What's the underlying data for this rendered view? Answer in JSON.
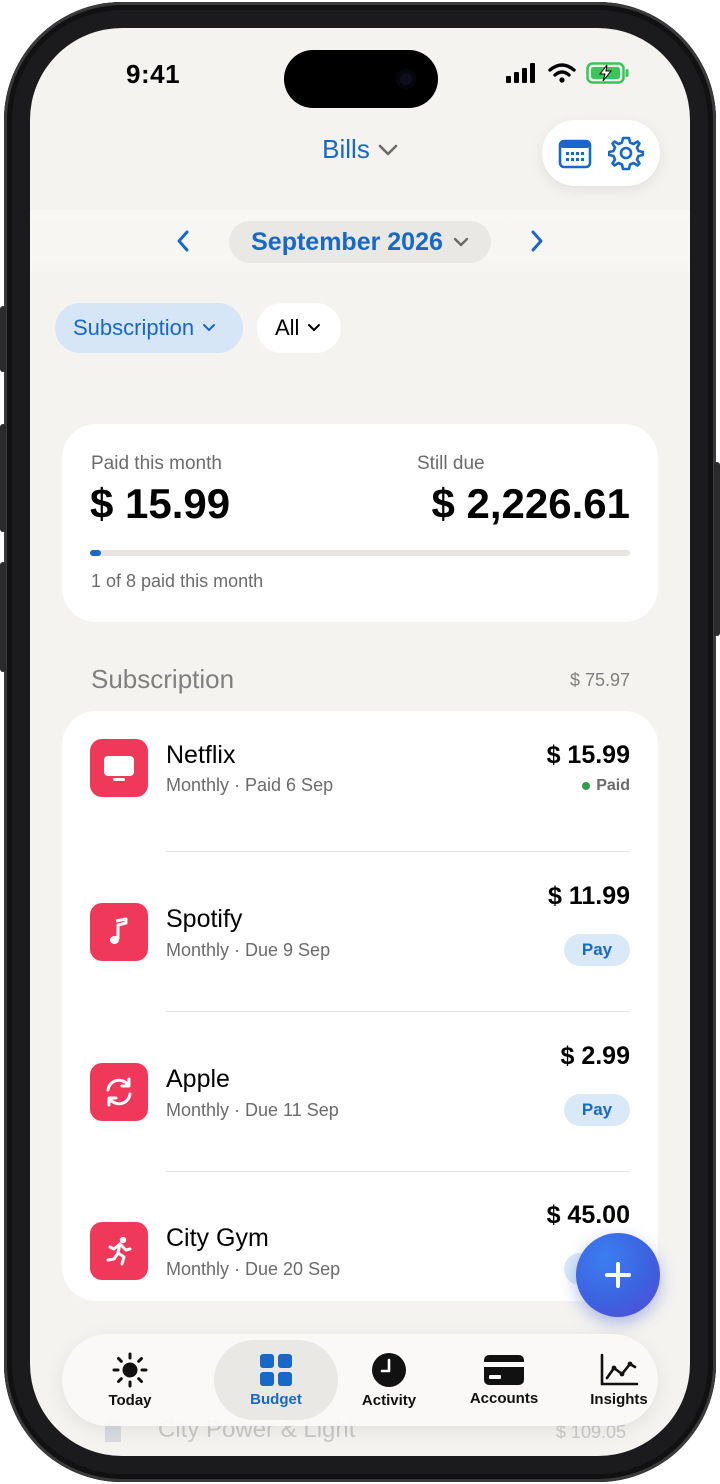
{
  "status_bar": {
    "time": "9:41"
  },
  "header": {
    "title": "Bills"
  },
  "month": {
    "label": "September 2026"
  },
  "filters": {
    "category": "Subscription",
    "scope": "All"
  },
  "summary": {
    "paid_label": "Paid this month",
    "paid_value": "$ 15.99",
    "due_label": "Still due",
    "due_value": "$ 2,226.61",
    "progress_fraction": 0.02,
    "footer": "1 of 8 paid this month"
  },
  "section": {
    "title": "Subscription",
    "total": "$ 75.97"
  },
  "bills": [
    {
      "name": "Netflix",
      "detail": "Monthly · Paid 6 Sep",
      "amount": "$ 15.99",
      "status": "Paid",
      "icon": "tv-icon"
    },
    {
      "name": "Spotify",
      "detail": "Monthly · Due 9 Sep",
      "amount": "$ 11.99",
      "action": "Pay",
      "icon": "music-note-icon"
    },
    {
      "name": "Apple",
      "detail": "Monthly · Due 11 Sep",
      "amount": "$ 2.99",
      "action": "Pay",
      "icon": "refresh-icon"
    },
    {
      "name": "City Gym",
      "detail": "Monthly · Due 20 Sep",
      "amount": "$ 45.00",
      "action": "Pay",
      "icon": "running-person-icon"
    }
  ],
  "next_section": {
    "name": "City Power & Light",
    "amount": "$ 109.05"
  },
  "tabbar": {
    "items": [
      {
        "label": "Today",
        "icon": "sun-icon"
      },
      {
        "label": "Budget",
        "icon": "grid-icon",
        "active": true
      },
      {
        "label": "Activity",
        "icon": "clock-icon"
      },
      {
        "label": "Accounts",
        "icon": "card-icon"
      },
      {
        "label": "Insights",
        "icon": "chart-icon"
      }
    ]
  },
  "colors": {
    "accent": "#1768c9",
    "bill_icon": "#f0385a",
    "paid": "#2e9d4b",
    "background": "#f4f3f0"
  }
}
